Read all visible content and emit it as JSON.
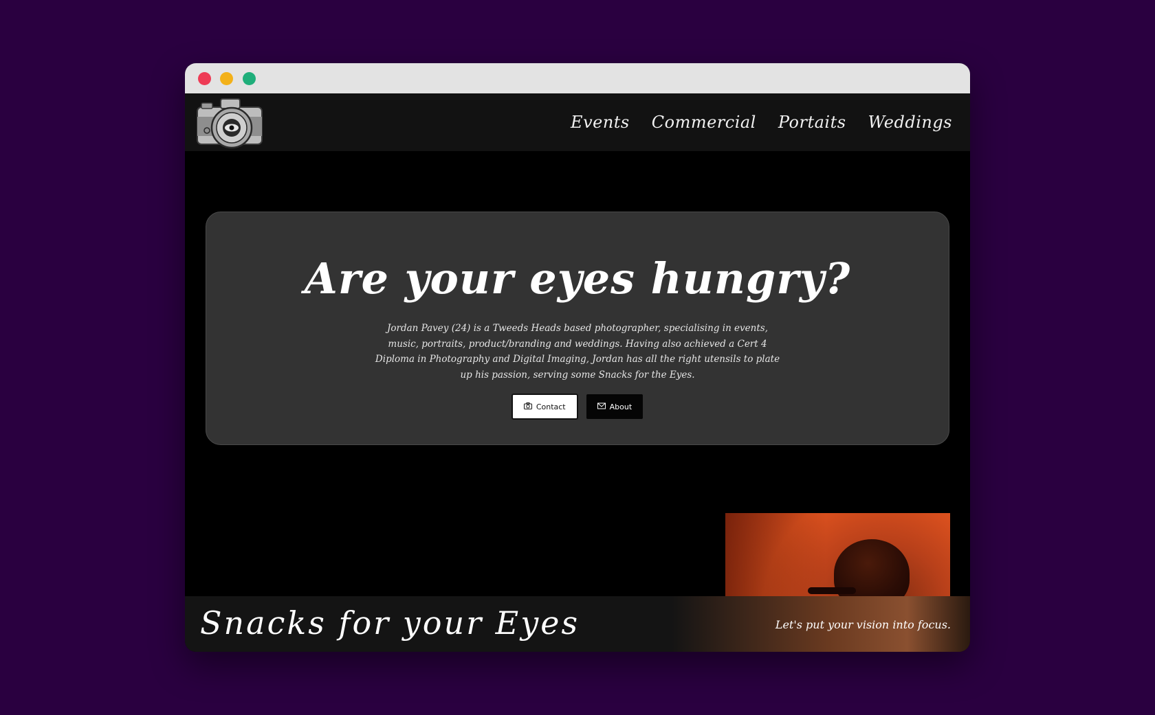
{
  "window": {
    "controls": [
      {
        "name": "close-button",
        "color": "#ee3b55"
      },
      {
        "name": "minimize-button",
        "color": "#f3b119"
      },
      {
        "name": "maximize-button",
        "color": "#1fae7a"
      }
    ]
  },
  "navbar": {
    "logo_icon": "camera-logo-icon",
    "links": [
      "Events",
      "Commercial",
      "Portaits",
      "Weddings"
    ]
  },
  "hero": {
    "title": "Are your eyes hungry?",
    "description": "Jordan Pavey (24) is a Tweeds Heads based photographer, specialising in events, music, portraits, product/branding and weddings. Having also achieved a Cert 4 Diploma in Photography and Digital Imaging, Jordan has all the right utensils to plate up his passion, serving some Snacks for the Eyes.",
    "buttons": {
      "contact": {
        "label": "Contact",
        "icon": "camera-icon"
      },
      "about": {
        "label": "About",
        "icon": "envelope-icon"
      }
    }
  },
  "photo": {
    "subject": "concert-performer-photo"
  },
  "footer": {
    "title": "Snacks for your Eyes",
    "tagline": "Let's put your vision into focus."
  },
  "colors": {
    "page_background": "#2a0040",
    "navbar": "#121212",
    "card": "#333333",
    "accent_orange": "#e0531f"
  }
}
